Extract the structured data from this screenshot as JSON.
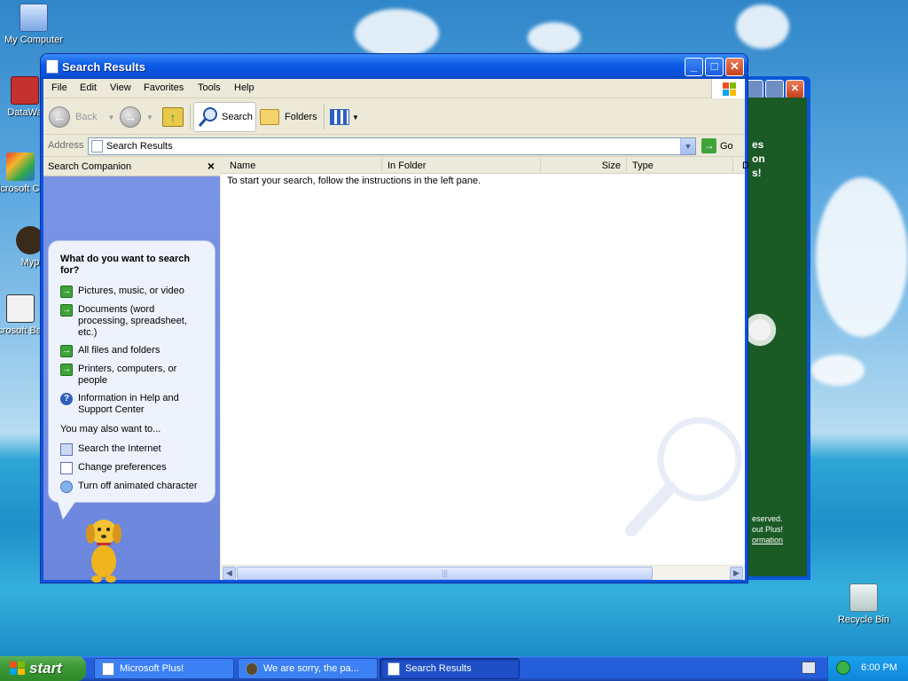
{
  "desktop": {
    "icons": [
      {
        "label": "My Computer"
      },
      {
        "label": "DataWa"
      },
      {
        "label": "Microsoft C++"
      },
      {
        "label": "Myp"
      },
      {
        "label": "Microsoft Basic"
      },
      {
        "label": "Recycle Bin"
      }
    ]
  },
  "background_window": {
    "visible_text_1": "es",
    "visible_text_2": "on",
    "visible_text_3": "s!",
    "footer_1": "eserved.",
    "footer_2": "out Plus!",
    "footer_3": "ormation"
  },
  "window": {
    "title": "Search Results",
    "menu": [
      "File",
      "Edit",
      "View",
      "Favorites",
      "Tools",
      "Help"
    ],
    "toolbar": {
      "back_label": "Back",
      "search_label": "Search",
      "folders_label": "Folders"
    },
    "address": {
      "label": "Address",
      "value": "Search Results",
      "go_label": "Go"
    },
    "companion": {
      "header": "Search Companion",
      "question": "What do you want to search for?",
      "options": [
        "Pictures, music, or video",
        "Documents (word processing, spreadsheet, etc.)",
        "All files and folders",
        "Printers, computers, or people",
        "Information in Help and Support Center"
      ],
      "also_label": "You may also want to...",
      "also_options": [
        "Search the Internet",
        "Change preferences",
        "Turn off animated character"
      ]
    },
    "results": {
      "columns": [
        "Name",
        "In Folder",
        "Size",
        "Type",
        "D"
      ],
      "message": "To start your search, follow the instructions in the left pane."
    }
  },
  "taskbar": {
    "start_label": "start",
    "tasks": [
      {
        "label": "Microsoft Plus!"
      },
      {
        "label": "We are sorry, the pa..."
      },
      {
        "label": "Search Results"
      }
    ],
    "clock": "6:00 PM"
  },
  "colors": {
    "title_blue": "#0a5ae6",
    "companion_blue": "#7a95e5",
    "start_green": "#3c9a36",
    "taskbar_blue": "#245edb"
  }
}
